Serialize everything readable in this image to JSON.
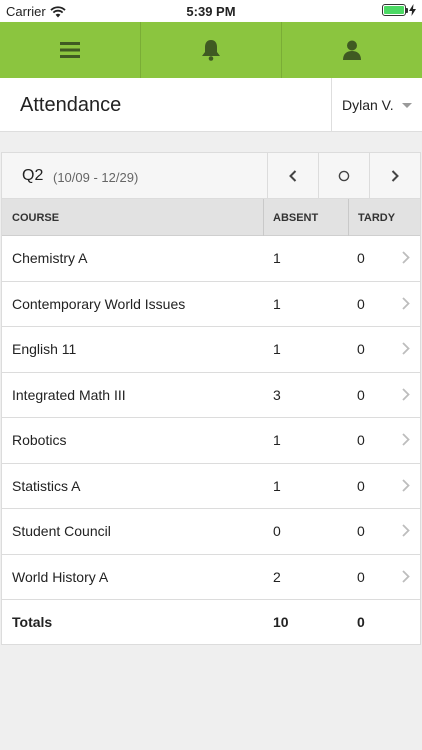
{
  "status_bar": {
    "carrier": "Carrier",
    "time": "5:39 PM"
  },
  "header": {
    "title": "Attendance",
    "student": "Dylan V."
  },
  "term": {
    "label": "Q2",
    "range": "(10/09 - 12/29)"
  },
  "columns": {
    "course": "COURSE",
    "absent": "ABSENT",
    "tardy": "TARDY"
  },
  "courses": [
    {
      "course": "Chemistry A",
      "absent": "1",
      "tardy": "0"
    },
    {
      "course": "Contemporary World Issues",
      "absent": "1",
      "tardy": "0"
    },
    {
      "course": "English 11",
      "absent": "1",
      "tardy": "0"
    },
    {
      "course": "Integrated Math III",
      "absent": "3",
      "tardy": "0"
    },
    {
      "course": "Robotics",
      "absent": "1",
      "tardy": "0"
    },
    {
      "course": "Statistics A",
      "absent": "1",
      "tardy": "0"
    },
    {
      "course": "Student Council",
      "absent": "0",
      "tardy": "0"
    },
    {
      "course": "World History A",
      "absent": "2",
      "tardy": "0"
    }
  ],
  "totals": {
    "label": "Totals",
    "absent": "10",
    "tardy": "0"
  },
  "icons": {
    "menu": "menu-icon",
    "bell": "bell-icon",
    "user": "user-icon",
    "prev": "chevron-left-icon",
    "current": "circle-icon",
    "next": "chevron-right-icon",
    "row": "chevron-right-icon"
  },
  "colors": {
    "accent": "#8bc53f",
    "nav_icon": "#3f5a22",
    "battery": "#4cd964"
  }
}
